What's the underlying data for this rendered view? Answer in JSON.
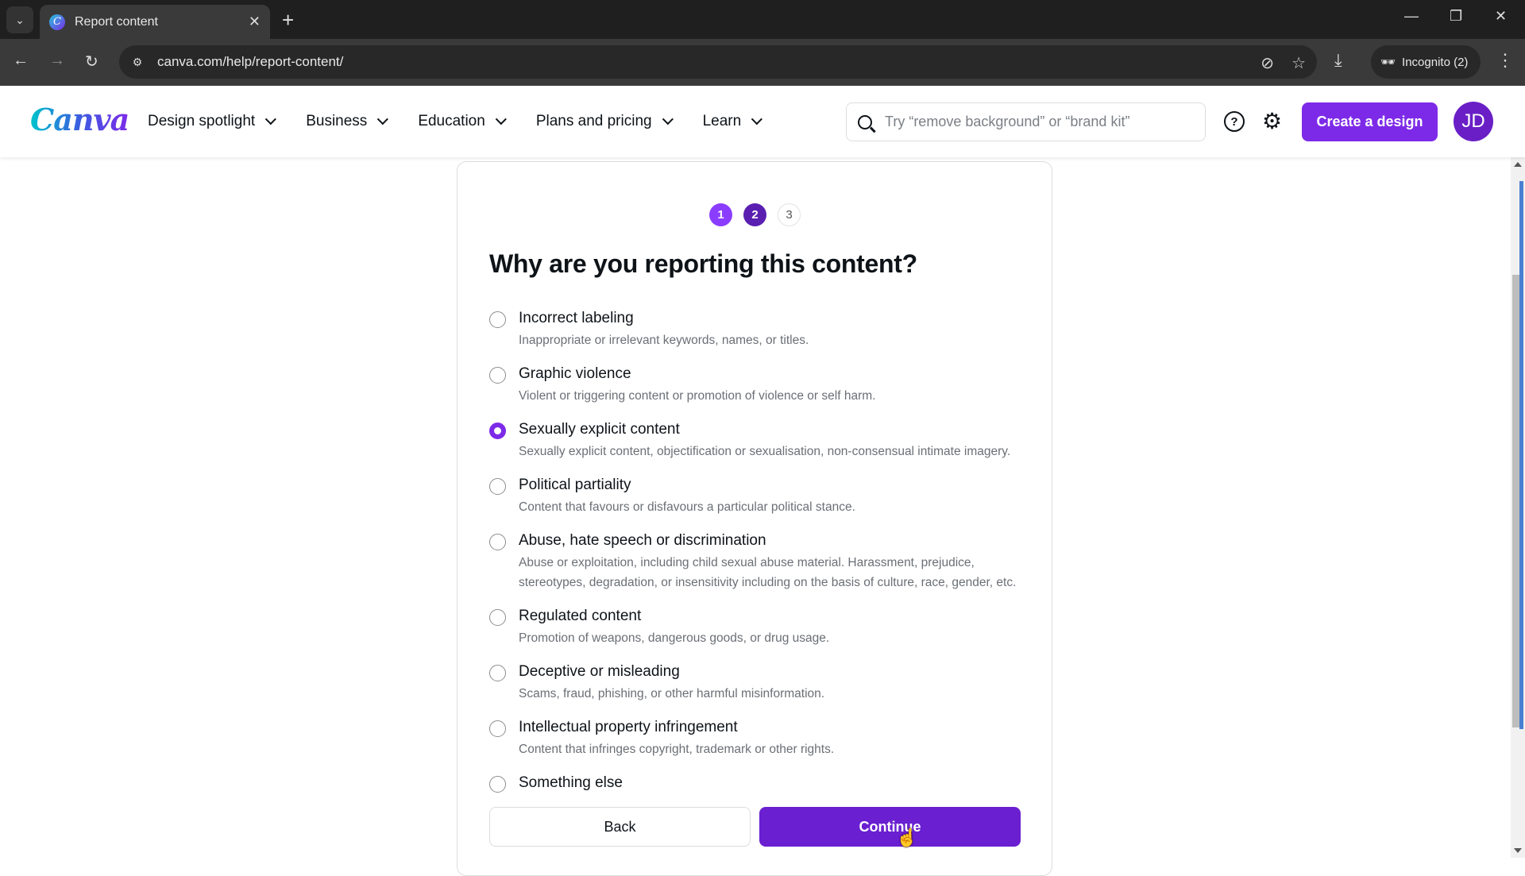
{
  "browser": {
    "tab_title": "Report content",
    "url": "canva.com/help/report-content/",
    "incognito_label": "Incognito (2)"
  },
  "header": {
    "logo": "Canva",
    "nav": [
      {
        "label": "Design spotlight"
      },
      {
        "label": "Business"
      },
      {
        "label": "Education"
      },
      {
        "label": "Plans and pricing"
      },
      {
        "label": "Learn"
      }
    ],
    "search_placeholder": "Try “remove background” or “brand kit”",
    "create_button": "Create a design",
    "avatar_initials": "JD",
    "brand_color": "#7d2ae8"
  },
  "form": {
    "steps": [
      "1",
      "2",
      "3"
    ],
    "current_step": 2,
    "title": "Why are you reporting this content?",
    "selected": "Sexually explicit content",
    "options": [
      {
        "label": "Incorrect labeling",
        "desc": "Inappropriate or irrelevant keywords, names, or titles."
      },
      {
        "label": "Graphic violence",
        "desc": "Violent or triggering content or promotion of violence or self harm."
      },
      {
        "label": "Sexually explicit content",
        "desc": "Sexually explicit content, objectification or sexualisation, non-consensual intimate imagery."
      },
      {
        "label": "Political partiality",
        "desc": "Content that favours or disfavours a particular political stance."
      },
      {
        "label": "Abuse, hate speech or discrimination",
        "desc": "Abuse or exploitation, including child sexual abuse material. Harassment, prejudice, stereotypes, degradation, or insensitivity including on the basis of culture, race, gender, etc."
      },
      {
        "label": "Regulated content",
        "desc": "Promotion of weapons, dangerous goods, or drug usage."
      },
      {
        "label": "Deceptive or misleading",
        "desc": "Scams, fraud, phishing, or other harmful misinformation."
      },
      {
        "label": "Intellectual property infringement",
        "desc": "Content that infringes copyright, trademark or other rights."
      },
      {
        "label": "Something else",
        "desc": ""
      }
    ],
    "back_label": "Back",
    "continue_label": "Continue"
  }
}
